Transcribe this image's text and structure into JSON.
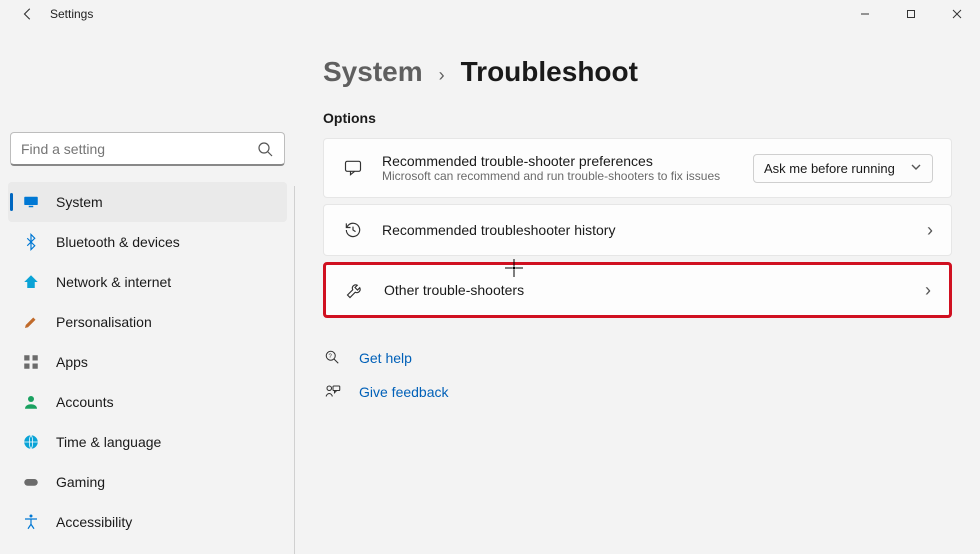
{
  "window": {
    "title": "Settings",
    "controls": {
      "minimize": "–",
      "maximize": "▢",
      "close": "✕"
    }
  },
  "search": {
    "placeholder": "Find a setting"
  },
  "sidebar": {
    "items": [
      {
        "icon": "display-icon",
        "label": "System",
        "color": "#0078d4"
      },
      {
        "icon": "bluetooth-icon",
        "label": "Bluetooth & devices",
        "color": "#0078d4"
      },
      {
        "icon": "wifi-icon",
        "label": "Network & internet",
        "color": "#0aa3d6"
      },
      {
        "icon": "brush-icon",
        "label": "Personalisation",
        "color": "#c06a2a"
      },
      {
        "icon": "apps-icon",
        "label": "Apps",
        "color": "#6b6b6b"
      },
      {
        "icon": "account-icon",
        "label": "Accounts",
        "color": "#1aa160"
      },
      {
        "icon": "globe-icon",
        "label": "Time & language",
        "color": "#0aa3d6"
      },
      {
        "icon": "gamepad-icon",
        "label": "Gaming",
        "color": "#6b6b6b"
      },
      {
        "icon": "accessibility-icon",
        "label": "Accessibility",
        "color": "#0078d4"
      }
    ],
    "active_index": 0
  },
  "breadcrumb": {
    "parent": "System",
    "current": "Troubleshoot"
  },
  "options_label": "Options",
  "cards": {
    "pref": {
      "title": "Recommended trouble-shooter preferences",
      "sub": "Microsoft can recommend and run trouble-shooters to fix issues",
      "dropdown": "Ask me before running"
    },
    "history": {
      "title": "Recommended troubleshooter history"
    },
    "other": {
      "title": "Other trouble-shooters"
    }
  },
  "links": {
    "help": "Get help",
    "feedback": "Give feedback"
  }
}
